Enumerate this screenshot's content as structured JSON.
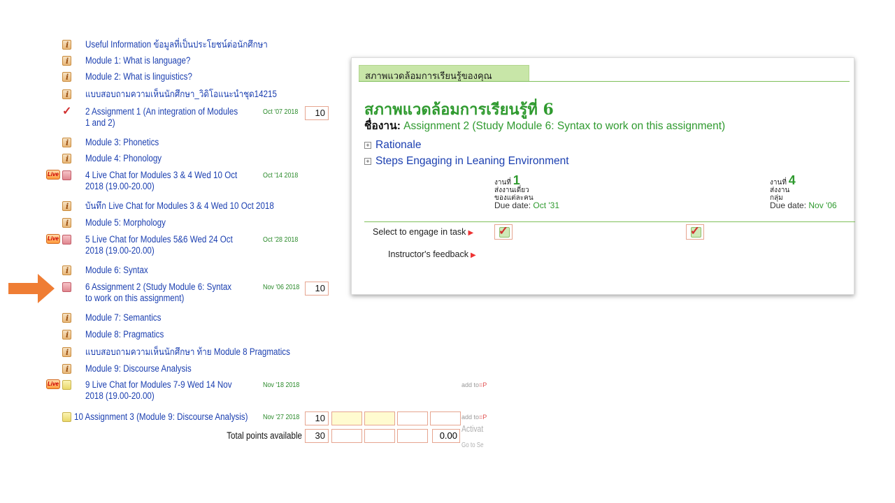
{
  "modules": [
    {
      "icon": "info-icon",
      "label": "Useful Information ข้อมูลที่เป็นประโยชน์ต่อนักศึกษา"
    },
    {
      "icon": "info-icon",
      "label": "Module 1: What is language?"
    },
    {
      "icon": "info-icon",
      "label": "Module 2: What is linguistics?"
    },
    {
      "icon": "info-icon",
      "label": "แบบสอบถามความเห็นนักศึกษา_วิดิโอแนะนำชุด14215"
    },
    {
      "icon": "checked-icon",
      "label": "2 Assignment 1 (An integration of Modules 1 and 2)",
      "date": "Oct '07 2018",
      "points": "10"
    },
    {
      "icon": "info-icon",
      "label": "Module 3: Phonetics"
    },
    {
      "icon": "info-icon",
      "label": "Module 4: Phonology"
    },
    {
      "icon": "red-task-icon",
      "live": "Live",
      "label": "4 Live Chat for Modules 3 & 4 Wed 10 Oct 2018 (19.00-20.00)",
      "date": "Oct '14 2018"
    },
    {
      "icon": "info-icon",
      "label": "บันทึก Live Chat for Modules 3 & 4 Wed 10 Oct 2018"
    },
    {
      "icon": "info-icon",
      "label": "Module 5: Morphology"
    },
    {
      "icon": "red-task-icon",
      "live": "Live",
      "label": "5 Live Chat for Modules 5&6 Wed 24 Oct 2018 (19.00-20.00)",
      "date": "Oct '28 2018"
    },
    {
      "icon": "info-icon",
      "label": "Module 6: Syntax"
    },
    {
      "icon": "red-task-icon",
      "label": "6 Assignment 2 (Study Module 6: Syntax to work on this assignment)",
      "date": "Nov '06 2018",
      "points": "10"
    },
    {
      "icon": "info-icon",
      "label": "Module 7: Semantics"
    },
    {
      "icon": "info-icon",
      "label": "Module 8: Pragmatics"
    },
    {
      "icon": "info-icon",
      "label": "แบบสอบถามความเห็นนักศึกษา ท้าย Module 8 Pragmatics"
    },
    {
      "icon": "info-icon",
      "label": "Module 9: Discourse Analysis"
    },
    {
      "icon": "yellow-task-icon",
      "live": "Live",
      "label": "9 Live Chat for Modules 7-9 Wed 14 Nov 2018 (19.00-20.00)",
      "date": "Nov '18 2018"
    },
    {
      "icon": "yellow-task-icon",
      "label": "10 Assignment 3 (Module 9: Discourse Analysis)",
      "date": "Nov '27 2018",
      "points": "10"
    }
  ],
  "add_to": {
    "prefix": "add to",
    "suffix": "P"
  },
  "total": {
    "label": "Total points available",
    "points": "30",
    "score": "0.00"
  },
  "watermark": {
    "line1": "Activat",
    "line2": "Go to Se"
  },
  "panel": {
    "tab": "สภาพแวดล้อมการเรียนรู้ของคุณ",
    "title": "สภาพแวดล้อมการเรียนรู้ที่ 6",
    "assignment_label": "ชื่องาน:",
    "assignment_name": "Assignment 2 (Study Module 6: Syntax to work on this assignment)",
    "rationale": "Rationale",
    "steps": "Steps Engaging in Leaning Environment",
    "task1": {
      "prefix": "งานที่",
      "number": "1",
      "line1": "ส่งงานเดี่ยว",
      "line2": "ของแต่ละคน",
      "due_label": "Due date:",
      "due_value": "Oct '31"
    },
    "task4": {
      "prefix": "งานที่",
      "number": "4",
      "line1": "ส่งงาน",
      "line2": "กลุ่ม",
      "due_label": "Due date:",
      "due_value": "Nov '06"
    },
    "select_label": "Select to engage in task",
    "feedback_label": "Instructor's feedback"
  },
  "colors": {
    "link": "#1b3fb0",
    "green": "#2f9a2f",
    "arrow": "#ef7d34",
    "tab_bg": "#c8e6a8"
  }
}
